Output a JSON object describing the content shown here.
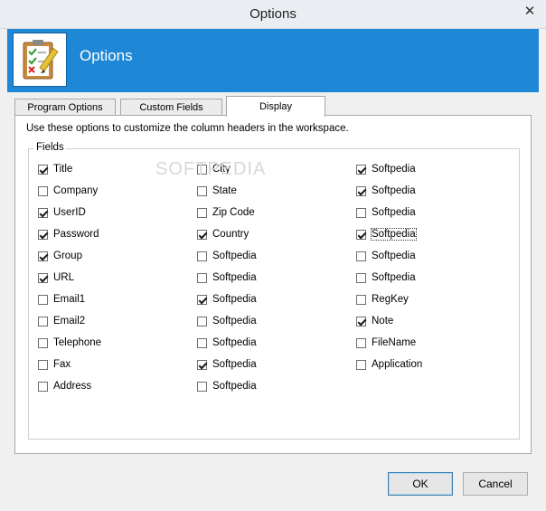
{
  "window": {
    "title": "Options"
  },
  "banner": {
    "title": "Options"
  },
  "tabs": [
    {
      "label": "Program Options",
      "active": false
    },
    {
      "label": "Custom Fields",
      "active": false
    },
    {
      "label": "Display",
      "active": true
    }
  ],
  "display": {
    "description": "Use these options to customize the column headers in the workspace.",
    "fields_label": "Fields",
    "columns": [
      [
        {
          "label": "Title",
          "checked": true
        },
        {
          "label": "Company",
          "checked": false
        },
        {
          "label": "UserID",
          "checked": true
        },
        {
          "label": "Password",
          "checked": true
        },
        {
          "label": "Group",
          "checked": true
        },
        {
          "label": "URL",
          "checked": true
        },
        {
          "label": "Email1",
          "checked": false
        },
        {
          "label": "Email2",
          "checked": false
        },
        {
          "label": "Telephone",
          "checked": false
        },
        {
          "label": "Fax",
          "checked": false
        },
        {
          "label": "Address",
          "checked": false
        }
      ],
      [
        {
          "label": "City",
          "checked": false
        },
        {
          "label": "State",
          "checked": false
        },
        {
          "label": "Zip Code",
          "checked": false
        },
        {
          "label": "Country",
          "checked": true
        },
        {
          "label": "Softpedia",
          "checked": false
        },
        {
          "label": "Softpedia",
          "checked": false
        },
        {
          "label": "Softpedia",
          "checked": true
        },
        {
          "label": "Softpedia",
          "checked": false
        },
        {
          "label": "Softpedia",
          "checked": false
        },
        {
          "label": "Softpedia",
          "checked": true
        },
        {
          "label": "Softpedia",
          "checked": false
        }
      ],
      [
        {
          "label": "Softpedia",
          "checked": true
        },
        {
          "label": "Softpedia",
          "checked": true
        },
        {
          "label": "Softpedia",
          "checked": false
        },
        {
          "label": "Softpedia",
          "checked": true,
          "focused": true
        },
        {
          "label": "Softpedia",
          "checked": false
        },
        {
          "label": "Softpedia",
          "checked": false
        },
        {
          "label": "RegKey",
          "checked": false
        },
        {
          "label": "Note",
          "checked": true
        },
        {
          "label": "FileName",
          "checked": false
        },
        {
          "label": "Application",
          "checked": false
        }
      ]
    ]
  },
  "watermark": "SOFTPEDIA",
  "buttons": {
    "ok": "OK",
    "cancel": "Cancel"
  },
  "icons": {
    "close": "close-icon",
    "app": "clipboard-checklist-icon"
  }
}
